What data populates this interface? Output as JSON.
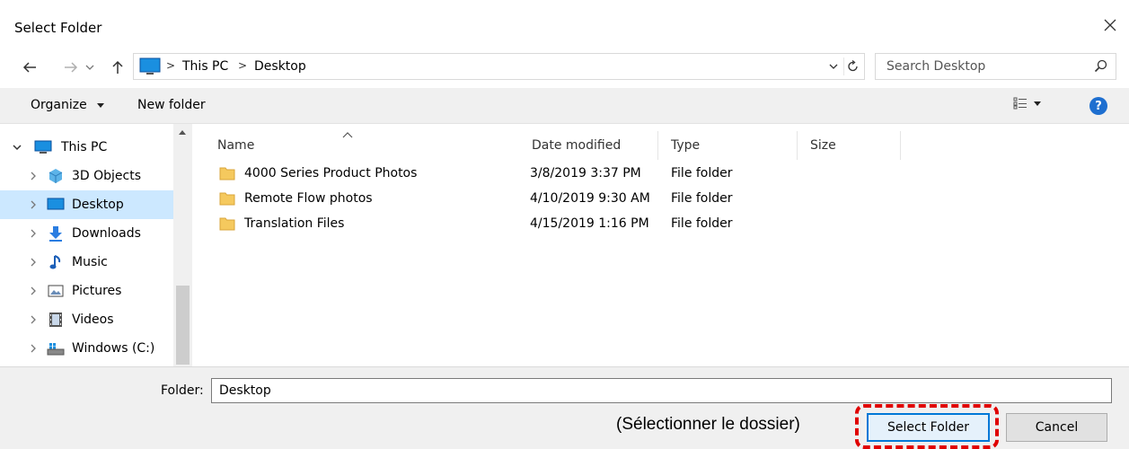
{
  "window": {
    "title": "Select Folder",
    "close_icon": "close-icon"
  },
  "nav": {
    "back_icon": "back-arrow-icon",
    "forward_icon": "forward-arrow-icon",
    "recent_icon": "chevron-down-icon",
    "up_icon": "up-arrow-icon"
  },
  "address": {
    "segments": [
      "This PC",
      "Desktop"
    ],
    "separator": ">",
    "dropdown_icon": "chevron-down-icon",
    "refresh_icon": "refresh-icon"
  },
  "search": {
    "placeholder": "Search Desktop",
    "icon": "search-icon"
  },
  "toolbar": {
    "organize_label": "Organize",
    "new_folder_label": "New folder",
    "views_icon": "view-options-icon",
    "help_icon": "help-icon",
    "help_symbol": "?"
  },
  "navpane": {
    "items": [
      {
        "label": "This PC",
        "icon": "computer-icon",
        "expanded": true
      },
      {
        "label": "3D Objects",
        "icon": "3d-objects-icon"
      },
      {
        "label": "Desktop",
        "icon": "desktop-icon",
        "selected": true
      },
      {
        "label": "Downloads",
        "icon": "downloads-icon"
      },
      {
        "label": "Music",
        "icon": "music-icon"
      },
      {
        "label": "Pictures",
        "icon": "pictures-icon"
      },
      {
        "label": "Videos",
        "icon": "videos-icon"
      },
      {
        "label": "Windows (C:)",
        "icon": "drive-icon"
      }
    ]
  },
  "filelist": {
    "columns": [
      "Name",
      "Date modified",
      "Type",
      "Size"
    ],
    "rows": [
      {
        "name": "4000 Series Product Photos",
        "date": "3/8/2019 3:37 PM",
        "type": "File folder",
        "size": ""
      },
      {
        "name": "Remote Flow photos",
        "date": "4/10/2019 9:30 AM",
        "type": "File folder",
        "size": ""
      },
      {
        "name": "Translation Files",
        "date": "4/15/2019 1:16 PM",
        "type": "File folder",
        "size": ""
      }
    ]
  },
  "footer": {
    "folder_label": "Folder:",
    "folder_value": "Desktop",
    "annotation": "(Sélectionner le dossier)",
    "select_label": "Select Folder",
    "cancel_label": "Cancel"
  },
  "colors": {
    "selection": "#cce8ff",
    "accent": "#0078d7",
    "annotation_border": "#e00000",
    "folder": "#f5c95e"
  }
}
